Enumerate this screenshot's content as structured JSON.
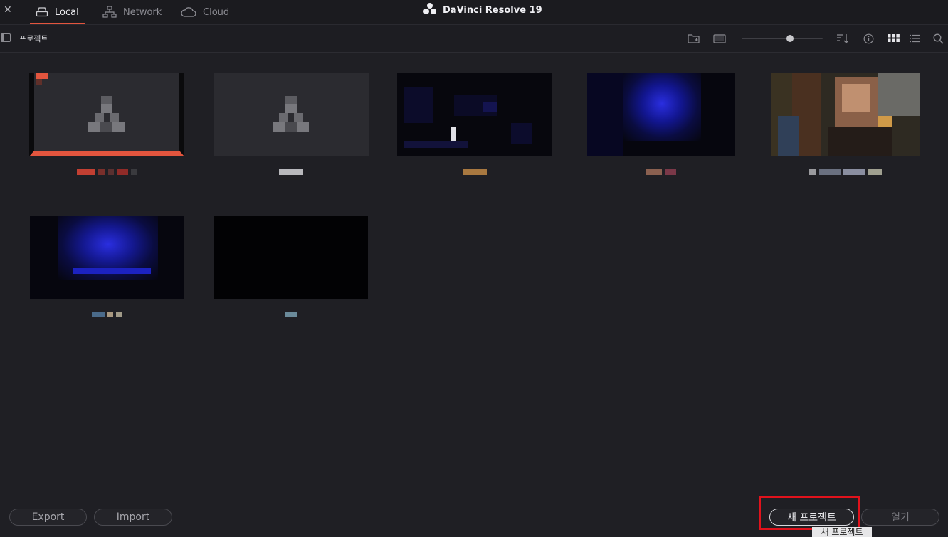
{
  "tabs": [
    {
      "label": "Local",
      "icon": "local-drive-icon",
      "active": true
    },
    {
      "label": "Network",
      "icon": "network-icon",
      "active": false
    },
    {
      "label": "Cloud",
      "icon": "cloud-icon",
      "active": false
    }
  ],
  "app": {
    "title": "DaVinci Resolve 19",
    "logo": "davinci-logo"
  },
  "breadcrumb": "프로젝트",
  "toolbar": {
    "icons": [
      "new-folder-icon",
      "thumbnail-view-icon",
      "sort-icon",
      "info-icon",
      "grid-view-icon",
      "list-view-icon",
      "search-icon"
    ],
    "zoom_level": 0.55
  },
  "projects": [
    {
      "id": 1,
      "selected": true,
      "type": "placeholder"
    },
    {
      "id": 2,
      "selected": false,
      "type": "placeholder"
    },
    {
      "id": 3,
      "selected": false,
      "type": "dark-blue"
    },
    {
      "id": 4,
      "selected": false,
      "type": "blue-spot"
    },
    {
      "id": 5,
      "selected": false,
      "type": "people"
    },
    {
      "id": 6,
      "selected": false,
      "type": "blue-spot"
    },
    {
      "id": 7,
      "selected": false,
      "type": "black"
    }
  ],
  "buttons": {
    "export": "Export",
    "import": "Import",
    "new_project": "새 프로젝트",
    "open": "열기"
  },
  "tooltip": "새 프로젝트",
  "colors": {
    "accent": "#e3553e",
    "highlight_box": "#e0121c",
    "background": "#1f1f24"
  }
}
